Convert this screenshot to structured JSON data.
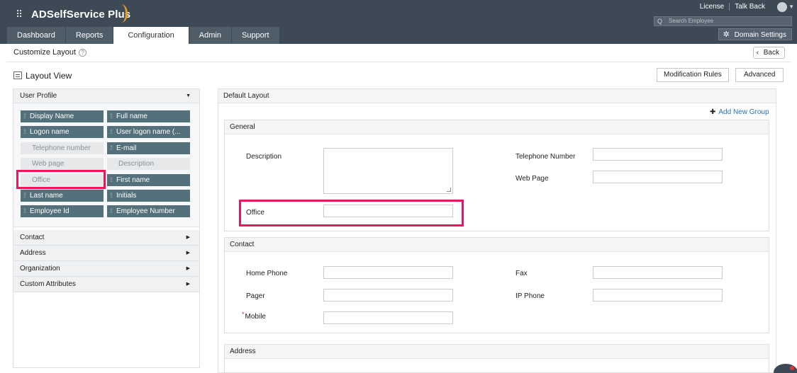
{
  "app": {
    "name": "ADSelfService Plus"
  },
  "top_links": {
    "license": "License",
    "talk_back": "Talk Back"
  },
  "search": {
    "placeholder": "Search Employee"
  },
  "nav": {
    "tabs": [
      "Dashboard",
      "Reports",
      "Configuration",
      "Admin",
      "Support"
    ],
    "active": "Configuration"
  },
  "domain_settings": "Domain Settings",
  "page": {
    "title": "Customize Layout",
    "back": "Back",
    "layout_view": "Layout View",
    "modification_rules": "Modification Rules",
    "advanced": "Advanced"
  },
  "left_panel": {
    "header": "User Profile",
    "fields": [
      {
        "label": "Display Name",
        "enabled": true
      },
      {
        "label": "Full name",
        "enabled": true
      },
      {
        "label": "Logon name",
        "enabled": true
      },
      {
        "label": "User logon name (...",
        "enabled": true
      },
      {
        "label": "Telephone number",
        "enabled": false
      },
      {
        "label": "E-mail",
        "enabled": true
      },
      {
        "label": "Web page",
        "enabled": false
      },
      {
        "label": "Description",
        "enabled": false
      },
      {
        "label": "Office",
        "enabled": false
      },
      {
        "label": "First name",
        "enabled": true
      },
      {
        "label": "Last name",
        "enabled": true
      },
      {
        "label": "Initials",
        "enabled": true
      },
      {
        "label": "Employee Id",
        "enabled": true
      },
      {
        "label": "Employee Number",
        "enabled": true
      }
    ],
    "sections": [
      "Contact",
      "Address",
      "Organization",
      "Custom Attributes"
    ]
  },
  "right_panel": {
    "header": "Default Layout",
    "add_group": "Add New Group",
    "groups": {
      "general": {
        "title": "General",
        "description": "Description",
        "office": "Office",
        "telephone": "Telephone Number",
        "web_page": "Web Page"
      },
      "contact": {
        "title": "Contact",
        "home_phone": "Home Phone",
        "pager": "Pager",
        "mobile": "Mobile",
        "fax": "Fax",
        "ip_phone": "IP Phone"
      },
      "address": {
        "title": "Address"
      }
    }
  },
  "colors": {
    "header_bg": "#3d4a56",
    "chip_enabled": "#54707a",
    "highlight": "#e8185a",
    "link": "#2a72b5"
  }
}
